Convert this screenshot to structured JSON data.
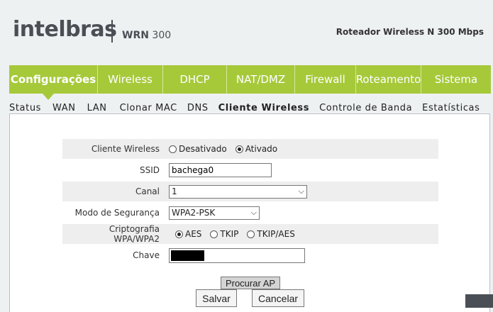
{
  "header": {
    "logo": "intelbras",
    "model_prefix": "WRN",
    "model_number": "300",
    "tagline": "Roteador Wireless N 300 Mbps"
  },
  "mainnav": {
    "items": [
      {
        "label": "Configurações"
      },
      {
        "label": "Wireless"
      },
      {
        "label": "DHCP"
      },
      {
        "label": "NAT/DMZ"
      },
      {
        "label": "Firewall"
      },
      {
        "label": "Roteamento"
      },
      {
        "label": "Sistema"
      }
    ]
  },
  "subnav": {
    "items": [
      "Status",
      "WAN",
      "LAN",
      "Clonar MAC",
      "DNS",
      "Cliente Wireless",
      "Controle de Banda",
      "Estatísticas"
    ]
  },
  "form": {
    "cliente_wireless": {
      "label": "Cliente Wireless",
      "opt_off": "Desativado",
      "opt_on": "Ativado",
      "selected": "Ativado"
    },
    "ssid": {
      "label": "SSID",
      "value": "bachega0"
    },
    "canal": {
      "label": "Canal",
      "value": "1"
    },
    "modo": {
      "label": "Modo de Segurança",
      "value": "WPA2-PSK"
    },
    "cripto": {
      "label": "Criptografia WPA/WPA2",
      "opt_aes": "AES",
      "opt_tkip": "TKIP",
      "opt_tkipaes": "TKIP/AES",
      "selected": "AES"
    },
    "chave": {
      "label": "Chave"
    }
  },
  "buttons": {
    "procurar": "Procurar AP",
    "salvar": "Salvar",
    "cancelar": "Cancelar"
  }
}
